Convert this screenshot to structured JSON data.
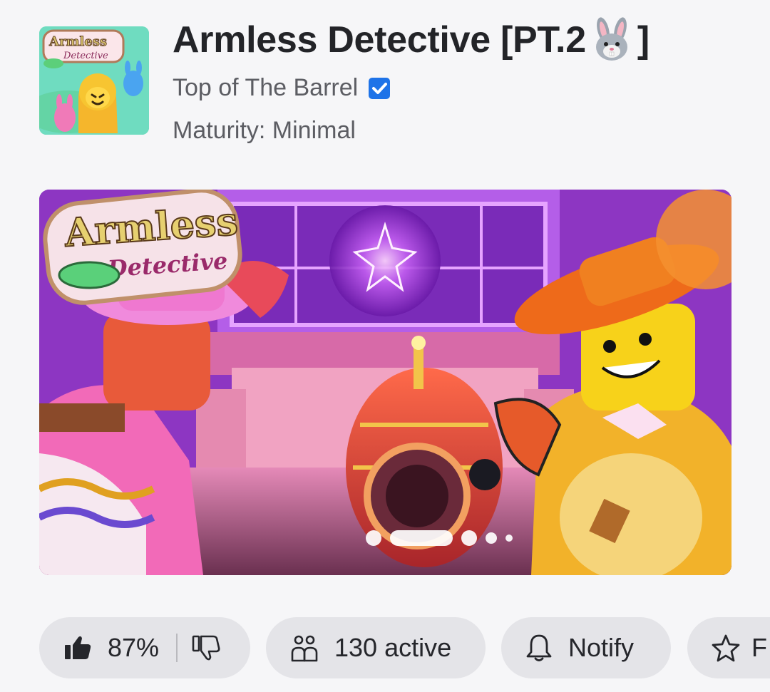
{
  "game": {
    "title_text": "Armless Detective [PT.2",
    "title_close": "]",
    "title_emoji": "bunny-face-emoji",
    "creator": "Top of The Barrel",
    "creator_verified_icon": "verified-check-icon",
    "maturity": "Maturity: Minimal"
  },
  "icon_logo": {
    "line1": "Armless",
    "line2": "Detective"
  },
  "hero": {
    "logo_line1": "Armless",
    "logo_line2": "Detective",
    "slide_count": 5,
    "active_slide": 2
  },
  "actions": {
    "vote": {
      "like_icon": "thumbs-up-icon",
      "percent": "87%",
      "dislike_icon": "thumbs-down-icon"
    },
    "active": {
      "icon": "people-icon",
      "label": "130 active"
    },
    "notify": {
      "icon": "bell-icon",
      "label": "Notify"
    },
    "favorite": {
      "icon": "star-icon",
      "label": "F"
    }
  },
  "colors": {
    "background": "#f6f6f8",
    "pill": "#e4e4e8",
    "verified_blue": "#1e73e8",
    "text_primary": "#232428",
    "text_secondary": "#5c5d63"
  }
}
